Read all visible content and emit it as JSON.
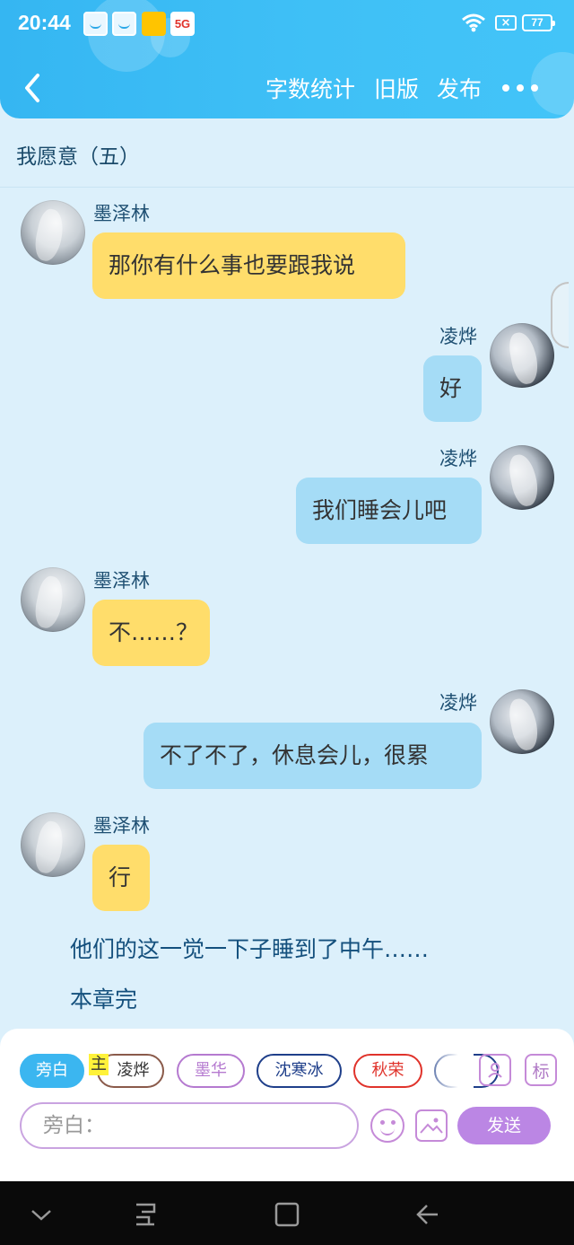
{
  "status_bar": {
    "time": "20:44",
    "battery": "77"
  },
  "nav": {
    "word_count": "字数统计",
    "old_version": "旧版",
    "publish": "发布"
  },
  "chapter_title": "我愿意（五）",
  "messages": [
    {
      "speaker": "墨泽林",
      "text": "那你有什么事也要跟我说",
      "side": "left"
    },
    {
      "speaker": "凌烨",
      "text": "好",
      "side": "right"
    },
    {
      "speaker": "凌烨",
      "text": "我们睡会儿吧",
      "side": "right"
    },
    {
      "speaker": "墨泽林",
      "text": "不……？",
      "side": "left"
    },
    {
      "speaker": "凌烨",
      "text": "不了不了，休息会儿，很累",
      "side": "right"
    },
    {
      "speaker": "墨泽林",
      "text": "行",
      "side": "left"
    }
  ],
  "narration": [
    "他们的这一觉一下子睡到了中午……",
    "本章完"
  ],
  "composer": {
    "characters": [
      {
        "label": "旁白",
        "color": "#3bb6f0"
      },
      {
        "label": "凌烨",
        "color": "#8a5a4a"
      },
      {
        "label": "墨华",
        "color": "#b57ad0"
      },
      {
        "label": "沈寒冰",
        "color": "#1f3f8a"
      },
      {
        "label": "秋荣",
        "color": "#e0332b"
      },
      {
        "label": "白",
        "color": "#1f3f8a"
      }
    ],
    "main_tag": "主",
    "tag_button": "标",
    "input_placeholder": "旁白：",
    "send": "发送"
  }
}
